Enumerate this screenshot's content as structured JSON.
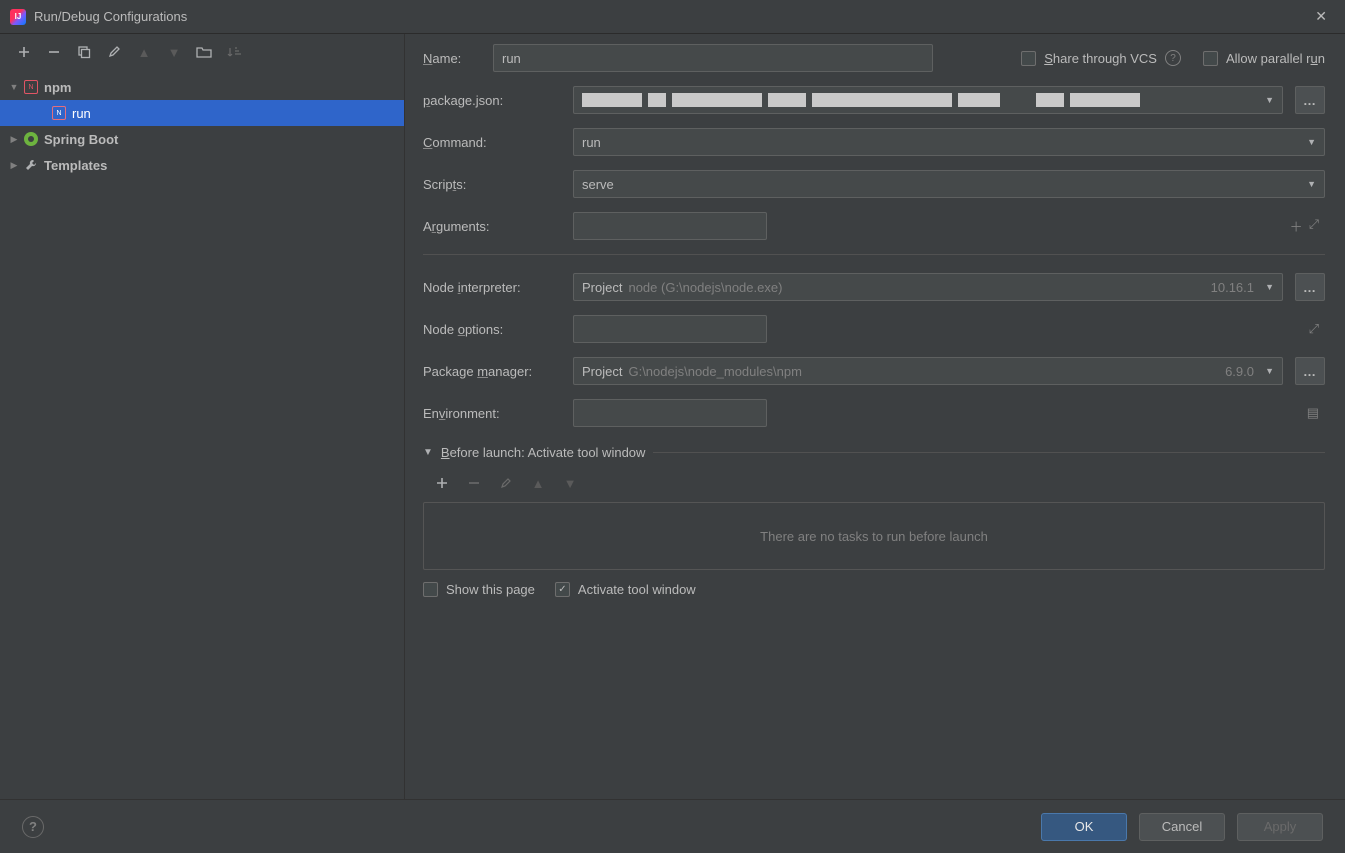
{
  "window": {
    "title": "Run/Debug Configurations"
  },
  "tree": {
    "items": [
      {
        "label": "npm",
        "icon": "npm",
        "expanded": true,
        "children": [
          {
            "label": "run",
            "icon": "npm",
            "selected": true
          }
        ]
      },
      {
        "label": "Spring Boot",
        "icon": "spring",
        "expanded": false
      },
      {
        "label": "Templates",
        "icon": "wrench",
        "expanded": false
      }
    ]
  },
  "form": {
    "name_label": "Name:",
    "name_value": "run",
    "share_label": "Share through VCS",
    "parallel_label": "Allow parallel run",
    "package_label": "package.json:",
    "command_label": "Command:",
    "command_value": "run",
    "scripts_label": "Scripts:",
    "scripts_value": "serve",
    "arguments_label": "Arguments:",
    "arguments_value": "",
    "node_interp_label": "Node interpreter:",
    "node_interp_prefix": "Project",
    "node_interp_path": "node (G:\\nodejs\\node.exe)",
    "node_interp_ver": "10.16.1",
    "node_options_label": "Node options:",
    "node_options_value": "",
    "pkg_mgr_label": "Package manager:",
    "pkg_mgr_prefix": "Project",
    "pkg_mgr_path": "G:\\nodejs\\node_modules\\npm",
    "pkg_mgr_ver": "6.9.0",
    "env_label": "Environment:",
    "env_value": "",
    "before_label": "Before launch: Activate tool window",
    "empty_tasks": "There are no tasks to run before launch",
    "show_page": "Show this page",
    "activate_tw": "Activate tool window"
  },
  "footer": {
    "ok": "OK",
    "cancel": "Cancel",
    "apply": "Apply"
  }
}
